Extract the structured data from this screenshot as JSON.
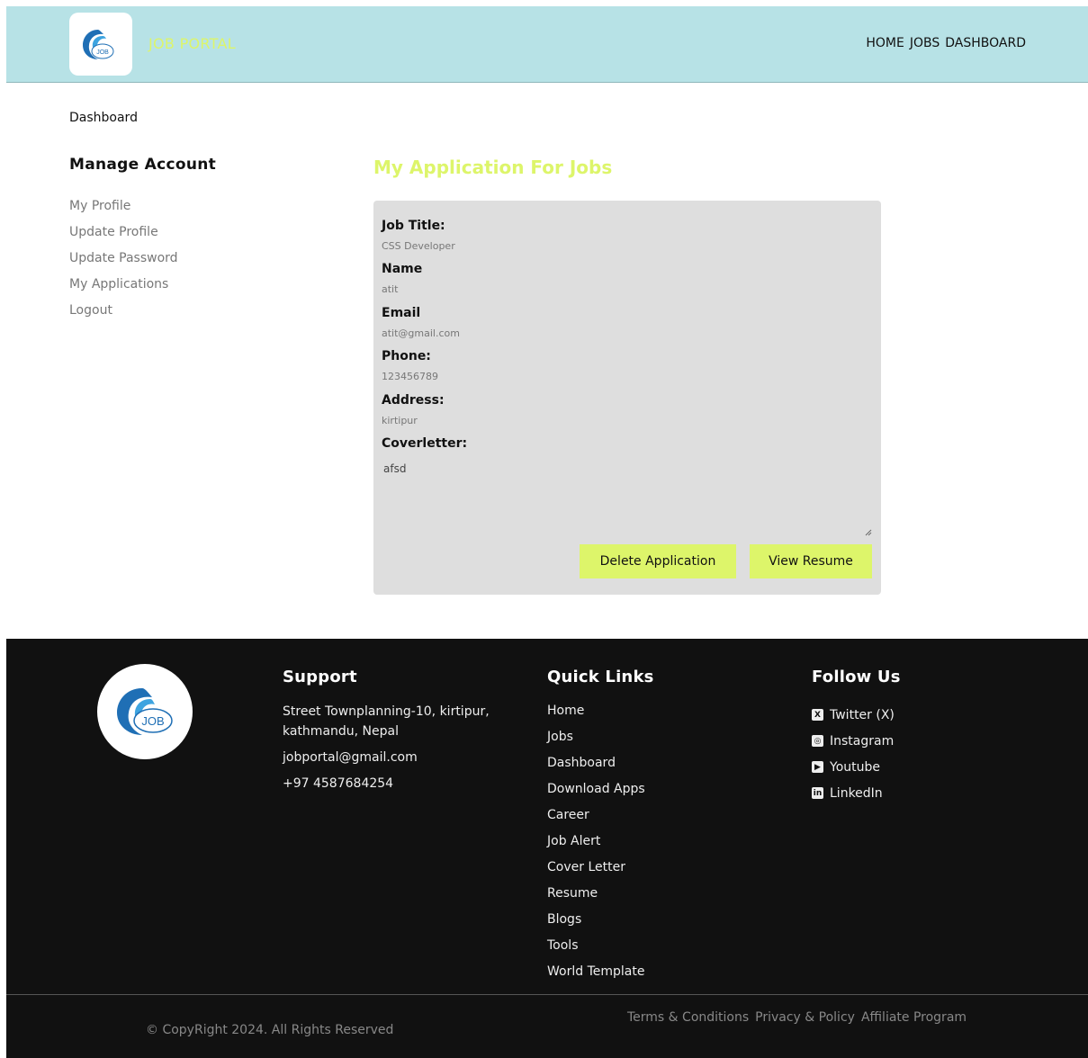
{
  "header": {
    "brand": "JOB PORTAL",
    "logo_text": "JOB",
    "nav": [
      "HOME",
      "JOBS",
      "DASHBOARD"
    ]
  },
  "breadcrumb": "Dashboard",
  "sidebar": {
    "title": "Manage Account",
    "items": [
      "My Profile",
      "Update Profile",
      "Update Password",
      "My Applications",
      "Logout"
    ]
  },
  "main": {
    "title": "My Application For Jobs",
    "application": {
      "job_title_label": "Job Title:",
      "job_title": "CSS Developer",
      "name_label": "Name",
      "name": "atit",
      "email_label": "Email",
      "email": "atit@gmail.com",
      "phone_label": "Phone:",
      "phone": "123456789",
      "address_label": "Address:",
      "address": "kirtipur",
      "coverletter_label": "Coverletter:",
      "coverletter": "afsd"
    },
    "delete_button": "Delete Application",
    "resume_button": "View Resume"
  },
  "footer": {
    "logo_text": "JOB",
    "support": {
      "title": "Support",
      "address_line1": "Street Townplanning-10, kirtipur,",
      "address_line2": "kathmandu, Nepal",
      "email": "jobportal@gmail.com",
      "phone": "+97 4587684254"
    },
    "quick_links": {
      "title": "Quick Links",
      "items": [
        "Home",
        "Jobs",
        "Dashboard",
        "Download Apps",
        "Career",
        "Job Alert",
        "Cover Letter",
        "Resume",
        "Blogs",
        "Tools",
        "World Template"
      ]
    },
    "follow": {
      "title": "Follow Us",
      "items": [
        {
          "label": "Twitter (X)",
          "icon": "x-icon"
        },
        {
          "label": "Instagram",
          "icon": "instagram-icon"
        },
        {
          "label": "Youtube",
          "icon": "youtube-icon"
        },
        {
          "label": "LinkedIn",
          "icon": "linkedin-icon"
        }
      ]
    },
    "copyright": "© CopyRight 2024. All Rights Reserved",
    "legal": [
      "Terms & Conditions",
      "Privacy & Policy",
      "Affiliate Program"
    ]
  },
  "colors": {
    "header_bg": "#b7e2e6",
    "accent": "#ddf56a",
    "card_bg": "#dedede",
    "footer_bg": "#111111",
    "logo_blue": "#1f6fb5"
  }
}
